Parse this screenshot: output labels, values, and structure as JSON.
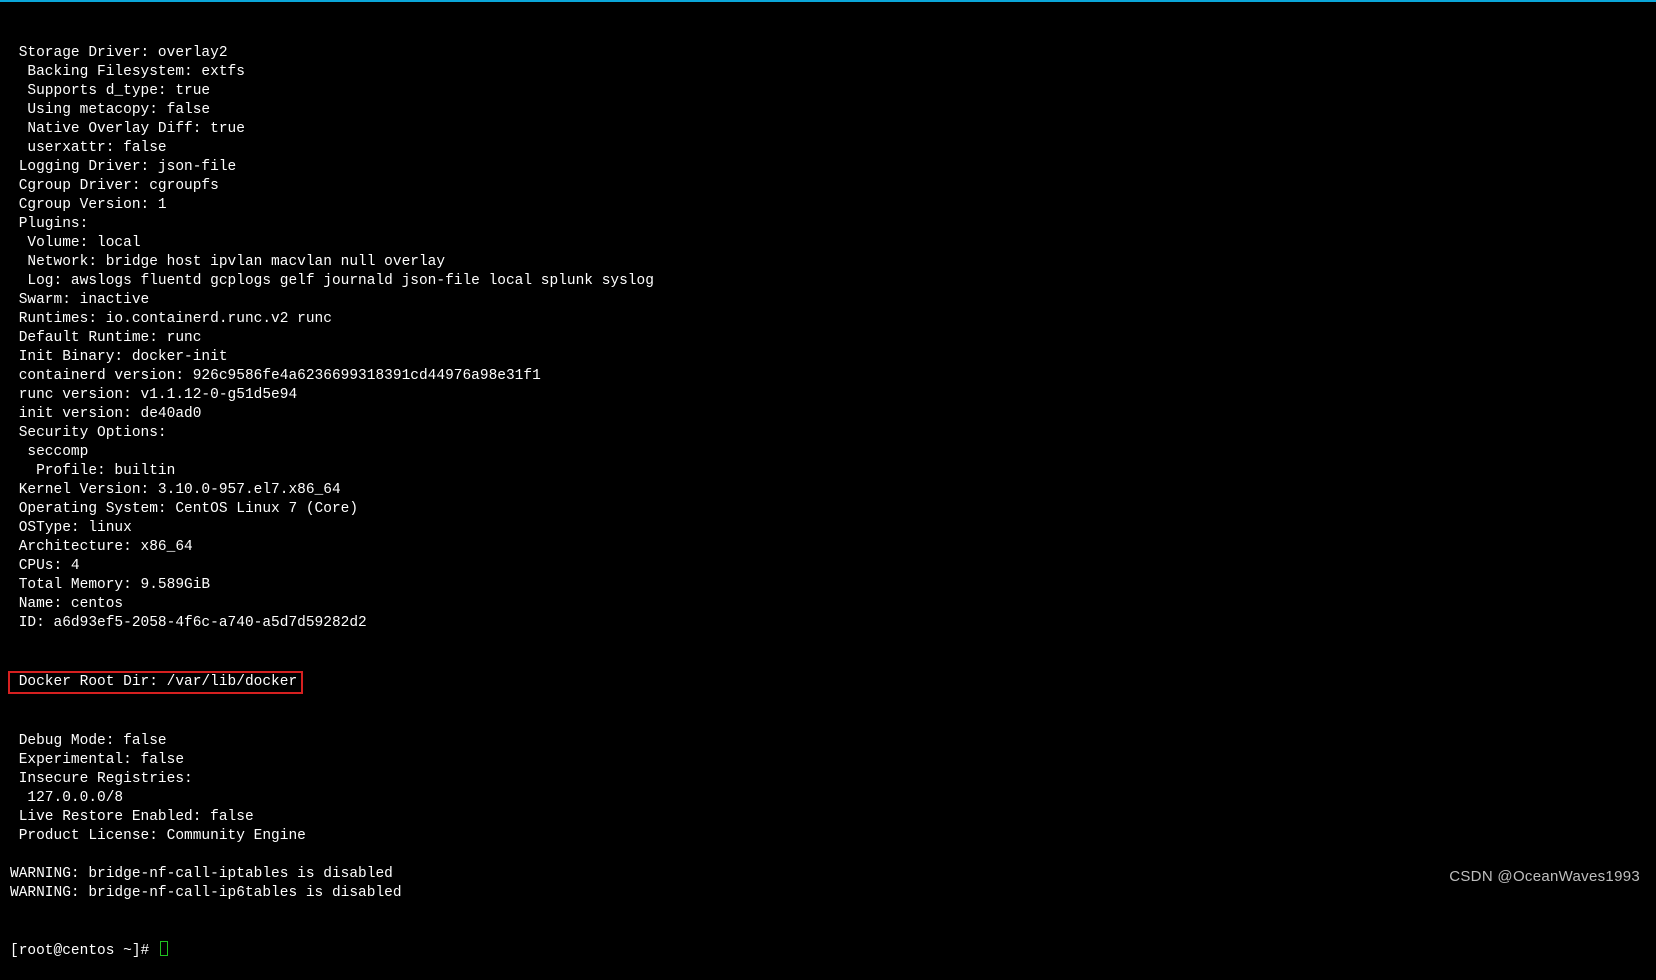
{
  "terminal": {
    "lines": [
      " Storage Driver: overlay2",
      "  Backing Filesystem: extfs",
      "  Supports d_type: true",
      "  Using metacopy: false",
      "  Native Overlay Diff: true",
      "  userxattr: false",
      " Logging Driver: json-file",
      " Cgroup Driver: cgroupfs",
      " Cgroup Version: 1",
      " Plugins:",
      "  Volume: local",
      "  Network: bridge host ipvlan macvlan null overlay",
      "  Log: awslogs fluentd gcplogs gelf journald json-file local splunk syslog",
      " Swarm: inactive",
      " Runtimes: io.containerd.runc.v2 runc",
      " Default Runtime: runc",
      " Init Binary: docker-init",
      " containerd version: 926c9586fe4a6236699318391cd44976a98e31f1",
      " runc version: v1.1.12-0-g51d5e94",
      " init version: de40ad0",
      " Security Options:",
      "  seccomp",
      "   Profile: builtin",
      " Kernel Version: 3.10.0-957.el7.x86_64",
      " Operating System: CentOS Linux 7 (Core)",
      " OSType: linux",
      " Architecture: x86_64",
      " CPUs: 4",
      " Total Memory: 9.589GiB",
      " Name: centos",
      " ID: a6d93ef5-2058-4f6c-a740-a5d7d59282d2"
    ],
    "highlighted_line": " Docker Root Dir: /var/lib/docker",
    "lines_after": [
      " Debug Mode: false",
      " Experimental: false",
      " Insecure Registries:",
      "  127.0.0.0/8",
      " Live Restore Enabled: false",
      " Product License: Community Engine",
      "",
      "WARNING: bridge-nf-call-iptables is disabled",
      "WARNING: bridge-nf-call-ip6tables is disabled"
    ],
    "prompt": "[root@centos ~]# "
  },
  "watermark": "CSDN @OceanWaves1993"
}
